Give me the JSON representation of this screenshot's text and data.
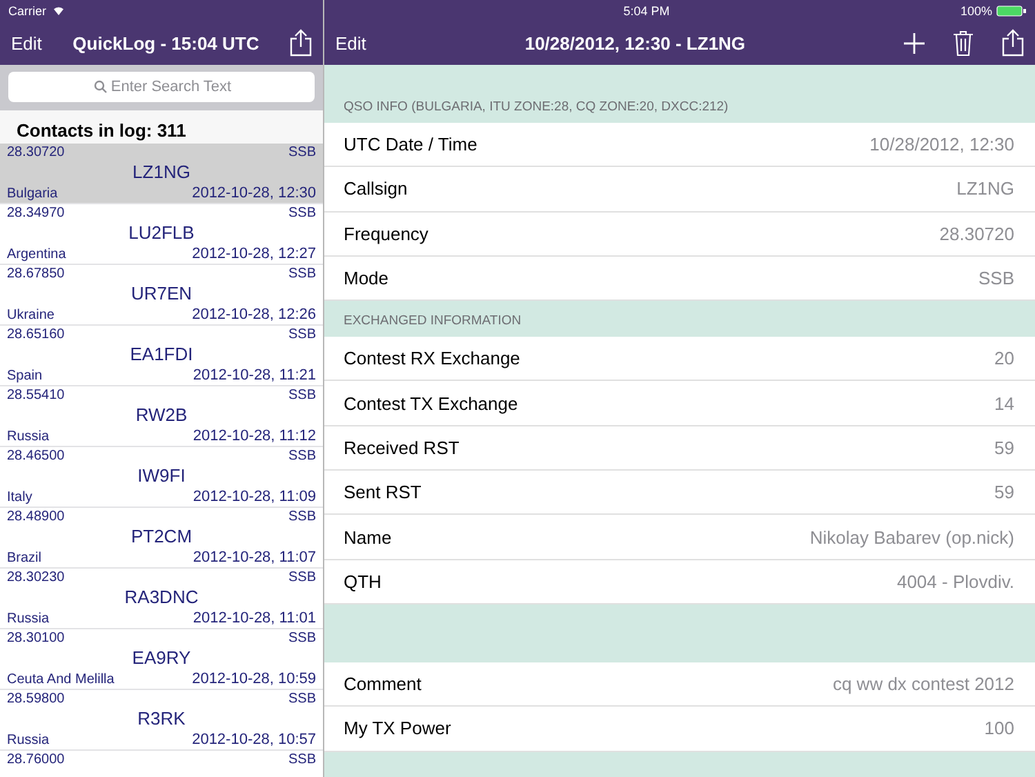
{
  "status_bar": {
    "carrier": "Carrier",
    "time": "5:04 PM",
    "battery": "100%"
  },
  "left_nav": {
    "edit": "Edit",
    "title": "QuickLog - 15:04 UTC"
  },
  "search": {
    "placeholder": "Enter Search Text"
  },
  "list_header": "Contacts in log: 311",
  "contacts": [
    {
      "frequency": "28.30720",
      "mode": "SSB",
      "callsign": "LZ1NG",
      "country": "Bulgaria",
      "datetime": "2012-10-28, 12:30",
      "selected": true
    },
    {
      "frequency": "28.34970",
      "mode": "SSB",
      "callsign": "LU2FLB",
      "country": "Argentina",
      "datetime": "2012-10-28, 12:27",
      "selected": false
    },
    {
      "frequency": "28.67850",
      "mode": "SSB",
      "callsign": "UR7EN",
      "country": "Ukraine",
      "datetime": "2012-10-28, 12:26",
      "selected": false
    },
    {
      "frequency": "28.65160",
      "mode": "SSB",
      "callsign": "EA1FDI",
      "country": "Spain",
      "datetime": "2012-10-28, 11:21",
      "selected": false
    },
    {
      "frequency": "28.55410",
      "mode": "SSB",
      "callsign": "RW2B",
      "country": "Russia",
      "datetime": "2012-10-28, 11:12",
      "selected": false
    },
    {
      "frequency": "28.46500",
      "mode": "SSB",
      "callsign": "IW9FI",
      "country": "Italy",
      "datetime": "2012-10-28, 11:09",
      "selected": false
    },
    {
      "frequency": "28.48900",
      "mode": "SSB",
      "callsign": "PT2CM",
      "country": "Brazil",
      "datetime": "2012-10-28, 11:07",
      "selected": false
    },
    {
      "frequency": "28.30230",
      "mode": "SSB",
      "callsign": "RA3DNC",
      "country": "Russia",
      "datetime": "2012-10-28, 11:01",
      "selected": false
    },
    {
      "frequency": "28.30100",
      "mode": "SSB",
      "callsign": "EA9RY",
      "country": "Ceuta And Melilla",
      "datetime": "2012-10-28, 10:59",
      "selected": false
    },
    {
      "frequency": "28.59800",
      "mode": "SSB",
      "callsign": "R3RK",
      "country": "Russia",
      "datetime": "2012-10-28, 10:57",
      "selected": false
    },
    {
      "frequency": "28.76000",
      "mode": "SSB",
      "selected": false
    }
  ],
  "right_nav": {
    "edit": "Edit",
    "title": "10/28/2012, 12:30 - LZ1NG"
  },
  "sections": [
    {
      "header": "QSO INFO (BULGARIA, ITU ZONE:28, CQ ZONE:20, DXCC:212)",
      "rows": [
        {
          "label": "UTC Date / Time",
          "value": "10/28/2012, 12:30"
        },
        {
          "label": "Callsign",
          "value": "LZ1NG"
        },
        {
          "label": "Frequency",
          "value": "28.30720"
        },
        {
          "label": "Mode",
          "value": "SSB"
        }
      ]
    },
    {
      "header": "EXCHANGED INFORMATION",
      "rows": [
        {
          "label": "Contest RX Exchange",
          "value": "20"
        },
        {
          "label": "Contest TX Exchange",
          "value": "14"
        },
        {
          "label": "Received RST",
          "value": "59"
        },
        {
          "label": "Sent RST",
          "value": "59"
        },
        {
          "label": "Name",
          "value": "Nikolay Babarev (op.nick)"
        },
        {
          "label": "QTH",
          "value": "4004 - Plovdiv."
        }
      ]
    },
    {
      "rows": [
        {
          "label": "Comment",
          "value": "cq ww dx contest 2012"
        },
        {
          "label": "My TX Power",
          "value": "100"
        }
      ]
    }
  ]
}
